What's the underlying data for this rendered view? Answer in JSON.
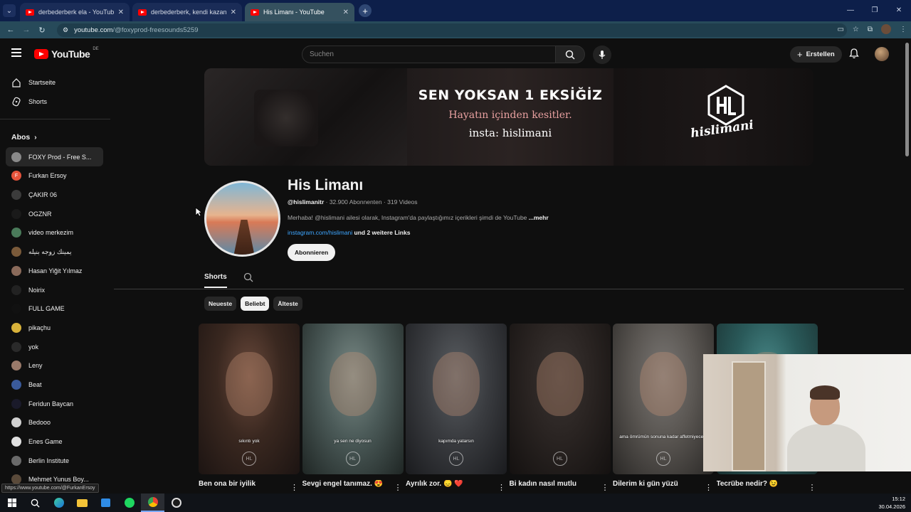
{
  "browser": {
    "tabs": [
      {
        "title": "derbederberk ela - YouTube",
        "active": false
      },
      {
        "title": "derbederberk, kendi kazandığı...",
        "active": false
      },
      {
        "title": "His Limanı - YouTube",
        "active": true
      }
    ],
    "url_host": "youtube.com",
    "url_path": "/@foxyprod-freesounds5259",
    "window_controls": [
      "minimize-icon",
      "restore-icon",
      "close-icon"
    ]
  },
  "masthead": {
    "logo_text": "YouTube",
    "country_code": "DE",
    "search_placeholder": "Suchen",
    "create_label": "Erstellen"
  },
  "sidebar": {
    "main": [
      {
        "label": "Startseite",
        "icon": "home-icon"
      },
      {
        "label": "Shorts",
        "icon": "shorts-icon"
      }
    ],
    "subs_header": "Abos",
    "subscriptions": [
      {
        "label": "FOXY Prod - Free S...",
        "color": "#8a8a8a",
        "selected": true
      },
      {
        "label": "Furkan Ersoy",
        "color": "#e5533b",
        "initial": "F"
      },
      {
        "label": "ÇAKIR 06",
        "color": "#3b3b3b"
      },
      {
        "label": "OGZNR",
        "color": "#1a1a1a"
      },
      {
        "label": "video merkezim",
        "color": "#4a7a5a"
      },
      {
        "label": "يمينك زوجه بنيله",
        "color": "#7a5a3a"
      },
      {
        "label": "Hasan Yiğit Yılmaz",
        "color": "#8a6a5a"
      },
      {
        "label": "Noirix",
        "color": "#222222"
      },
      {
        "label": "FULL GAME",
        "color": "#111111"
      },
      {
        "label": "pikaçhu",
        "color": "#d8b23a"
      },
      {
        "label": "yok",
        "color": "#2a2a2a"
      },
      {
        "label": "Leny",
        "color": "#9a7a6a"
      },
      {
        "label": "Beat",
        "color": "#3a5a9a"
      },
      {
        "label": "Feridun Baycan",
        "color": "#1a1a2a"
      },
      {
        "label": "Bedooo",
        "color": "#d0d0d0"
      },
      {
        "label": "Enes Game",
        "color": "#e0e0e0"
      },
      {
        "label": "Berlin Institute",
        "color": "#6a6a6a"
      },
      {
        "label": "Mehmet Yunus Boy...",
        "color": "#5a4a3a"
      }
    ]
  },
  "banner": {
    "line1": "SEN YOKSAN 1 EKSİĞİZ",
    "line2": "Hayatın içinden kesitler.",
    "line3": "insta: hislimani",
    "logo_text": "hislimani"
  },
  "channel": {
    "name": "His Limanı",
    "handle": "@hislimanitr",
    "meta": " · 32.900 Abonnenten · 319 Videos",
    "description": "Merhaba! @hislimani ailesi olarak, Instagram'da paylaştığımız içerikleri şimdi de YouTube",
    "more": "...mehr",
    "link": "instagram.com/hislimani",
    "more_links": " und 2 weitere Links",
    "subscribe_label": "Abonnieren"
  },
  "tabs": {
    "active": "Shorts"
  },
  "chips": [
    {
      "label": "Neueste",
      "selected": false
    },
    {
      "label": "Beliebt",
      "selected": true
    },
    {
      "label": "Älteste",
      "selected": false
    }
  ],
  "shorts": [
    {
      "title": "Ben ona bir iyilik",
      "caption": "sıkıntı yok",
      "colors": [
        "#6b4a3c",
        "#3a2820",
        "#1c1412"
      ]
    },
    {
      "title": "Sevgi engel tanımaz. 😍",
      "caption": "ya sen ne diyosun",
      "colors": [
        "#7a8a86",
        "#4b5a58",
        "#1f2624"
      ]
    },
    {
      "title": "Ayrılık zor. 😞 ❤️",
      "caption": "kapımda yatarsın",
      "colors": [
        "#5a5e62",
        "#3a3c40",
        "#1a1b1e"
      ]
    },
    {
      "title": "Bi kadın nasıl mutlu",
      "caption": "",
      "colors": [
        "#3a3432",
        "#2a2422",
        "#141110"
      ]
    },
    {
      "title": "Dilerim ki gün yüzü",
      "caption": "ama ömrümün sonuna kadar affetmiyecem",
      "colors": [
        "#7a7774",
        "#5a5652",
        "#2a2826"
      ]
    },
    {
      "title": "Tecrübe nedir? 😉",
      "caption": "",
      "colors": [
        "#4a8a8a",
        "#2a5a5a",
        "#1a3030"
      ]
    }
  ],
  "status_url": "https://www.youtube.com/@FurkanErsoy",
  "taskbar": {
    "icons": [
      "windows-start-icon",
      "search-icon",
      "edge-icon",
      "file-explorer-icon",
      "store-icon",
      "spotify-icon",
      "chrome-icon",
      "obs-icon"
    ],
    "time": "15:12",
    "date": "30.04.2026"
  }
}
